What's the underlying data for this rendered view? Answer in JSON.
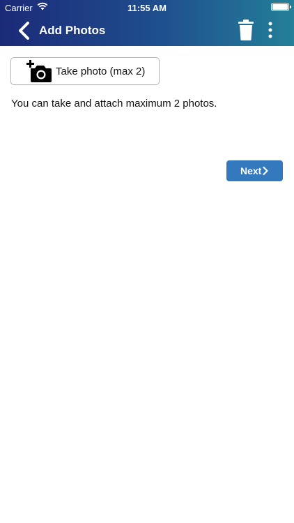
{
  "status": {
    "carrier": "Carrier",
    "time": "11:55 AM"
  },
  "navbar": {
    "title": "Add Photos",
    "header_gradient": [
      "#1b2a78",
      "#247f98"
    ]
  },
  "main": {
    "take_photo_label": "Take photo (max 2)",
    "info_text": "You can take and attach maximum 2 photos.",
    "next_label": "Next",
    "accent": "#3478bd"
  },
  "icons": [
    "wifi-icon",
    "battery-icon",
    "back-chevron-icon",
    "trash-icon",
    "more-vertical-icon",
    "add-camera-icon",
    "chevron-right-icon"
  ]
}
